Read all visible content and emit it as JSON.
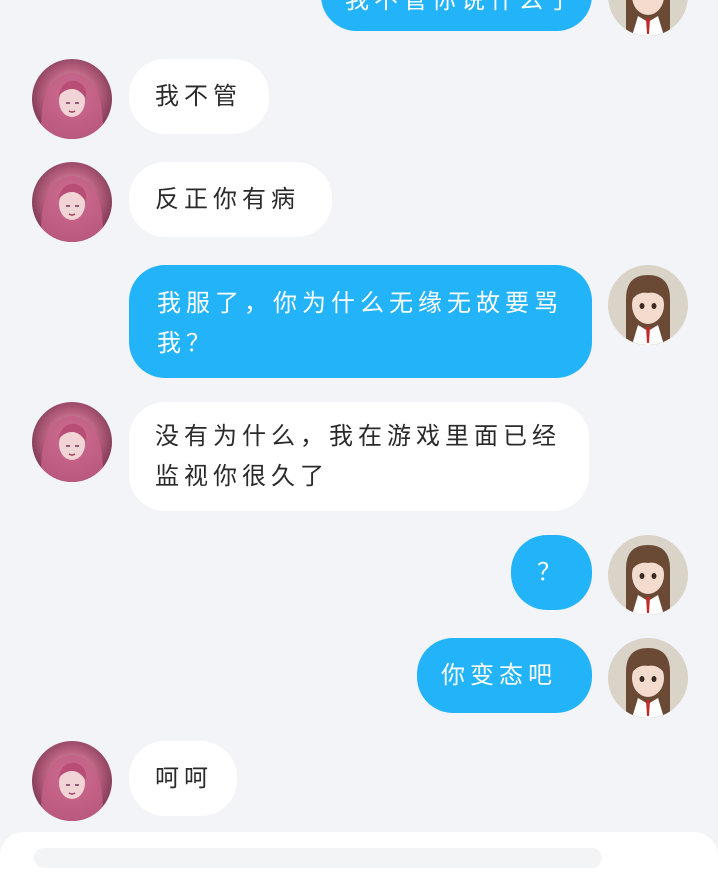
{
  "messages": [
    {
      "sender": "self",
      "text": "我不管你说什么了"
    },
    {
      "sender": "other",
      "text": "我不管"
    },
    {
      "sender": "other",
      "text": "反正你有病"
    },
    {
      "sender": "self",
      "text": "我服了，你为什么无缘无故要骂我？"
    },
    {
      "sender": "other",
      "text": "没有为什么，我在游戏里面已经监视你很久了"
    },
    {
      "sender": "self",
      "text": "？"
    },
    {
      "sender": "self",
      "text": "你变态吧"
    },
    {
      "sender": "other",
      "text": "呵呵"
    }
  ],
  "input": {
    "placeholder": ""
  },
  "colors": {
    "background": "#f2f4f7",
    "incoming_bubble": "#ffffff",
    "outgoing_bubble": "#22b3f8"
  }
}
